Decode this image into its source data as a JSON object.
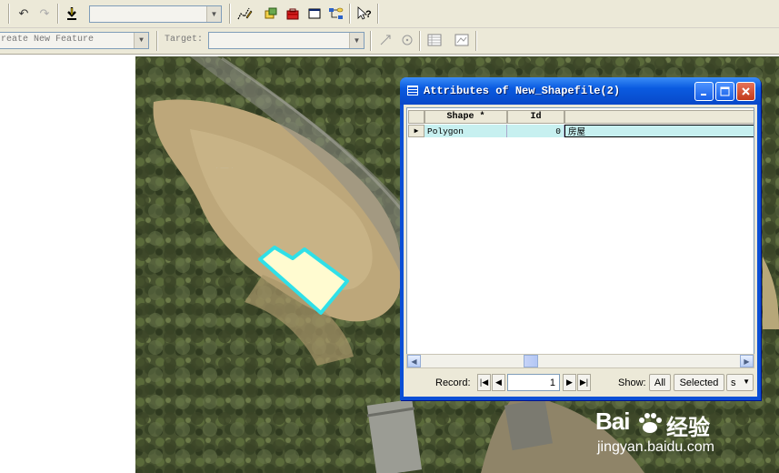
{
  "toolbar1": {
    "undo_icon": "undo-icon",
    "redo_icon": "redo-icon",
    "add_data_icon": "add-data-icon",
    "scale_value": "",
    "tools": [
      "editor-icon",
      "arccatalog-icon",
      "arctoolbox-icon",
      "command-line-icon",
      "modelbuilder-icon",
      "whats-this-icon"
    ]
  },
  "toolbar2": {
    "task_label": "reate New Feature",
    "target_label": "Target:",
    "target_value": ""
  },
  "attribute_window": {
    "title": "Attributes of New_Shapefile(2)",
    "columns": [
      "Shape *",
      "Id",
      ""
    ],
    "rows": [
      {
        "shape": "Polygon",
        "id": "0",
        "extra": "房屋"
      }
    ],
    "record_label": "Record:",
    "record_value": "1",
    "show_label": "Show:",
    "all_label": "All",
    "selected_label": "Selected",
    "options_label": "s"
  },
  "watermark": {
    "brand": "Bai",
    "brand_cn": "经验",
    "url": "jingyan.baidu.com"
  },
  "colors": {
    "title_bar": "#0a5be0",
    "selected_row": "#c7f0f0",
    "polygon_fill": "#fffbd0",
    "polygon_stroke": "#2fe0e8"
  }
}
